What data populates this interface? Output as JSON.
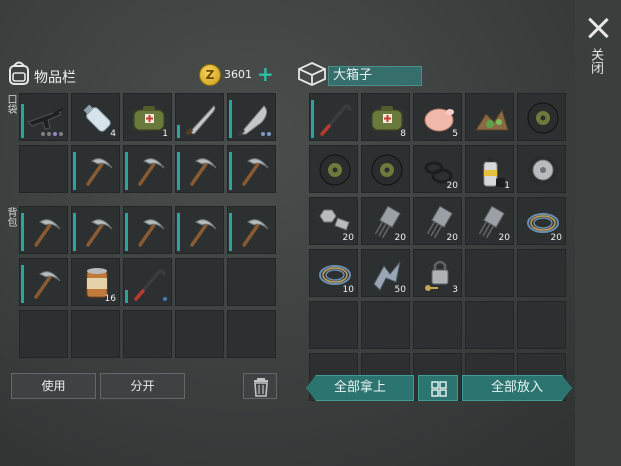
{
  "close": {
    "label": "关闭"
  },
  "inventory": {
    "title": "物品栏",
    "coins": "3601",
    "coin_symbol": "Z",
    "pocket_label": "口袋",
    "backpack_label": "背包",
    "pocket_slots": [
      {
        "item": "assault-rifle-icon",
        "qty": "",
        "dots": [
          "#7f7f7f",
          "#7f7f7f",
          "#9a7fd8",
          "#7f7f7f"
        ],
        "bar": 0.8
      },
      {
        "item": "water-bottle-icon",
        "qty": "4",
        "dots": [],
        "bar": 0
      },
      {
        "item": "medkit-bag-icon",
        "qty": "1",
        "dots": [],
        "bar": 0
      },
      {
        "item": "machete-icon",
        "qty": "",
        "dots": [],
        "bar": 0.3
      },
      {
        "item": "cleaver-icon",
        "qty": "",
        "dots": [
          "#7a9ac8",
          "#7a9ac8"
        ],
        "bar": 0.9
      },
      {
        "item": "",
        "qty": "",
        "dots": [],
        "bar": 0
      },
      {
        "item": "pickaxe-icon",
        "qty": "",
        "dots": [],
        "bar": 0.9
      },
      {
        "item": "pickaxe-icon",
        "qty": "",
        "dots": [],
        "bar": 0.9
      },
      {
        "item": "pickaxe-icon",
        "qty": "",
        "dots": [],
        "bar": 0.9
      },
      {
        "item": "pickaxe-icon",
        "qty": "",
        "dots": [],
        "bar": 0.9
      }
    ],
    "backpack_slots": [
      {
        "item": "pickaxe-icon",
        "qty": "",
        "dots": [],
        "bar": 0.9
      },
      {
        "item": "pickaxe-icon",
        "qty": "",
        "dots": [],
        "bar": 0.9
      },
      {
        "item": "pickaxe-icon",
        "qty": "",
        "dots": [],
        "bar": 0.9
      },
      {
        "item": "pickaxe-icon",
        "qty": "",
        "dots": [],
        "bar": 0.9
      },
      {
        "item": "pickaxe-icon",
        "qty": "",
        "dots": [],
        "bar": 0.9
      },
      {
        "item": "pickaxe-icon",
        "qty": "",
        "dots": [],
        "bar": 0.9
      },
      {
        "item": "canned-food-icon",
        "qty": "16",
        "dots": [],
        "bar": 0
      },
      {
        "item": "crowbar-icon",
        "qty": "",
        "dots": [
          "#4a7ab8"
        ],
        "bar": 0.3
      },
      {
        "item": "",
        "qty": "",
        "dots": [],
        "bar": 0
      },
      {
        "item": "",
        "qty": "",
        "dots": [],
        "bar": 0
      },
      {
        "item": "",
        "qty": "",
        "dots": [],
        "bar": 0
      },
      {
        "item": "",
        "qty": "",
        "dots": [],
        "bar": 0
      },
      {
        "item": "",
        "qty": "",
        "dots": [],
        "bar": 0
      },
      {
        "item": "",
        "qty": "",
        "dots": [],
        "bar": 0
      },
      {
        "item": "",
        "qty": "",
        "dots": [],
        "bar": 0
      }
    ],
    "buttons": {
      "use": "使用",
      "split": "分开"
    }
  },
  "container": {
    "title": "大箱子",
    "slots": [
      {
        "item": "crowbar-icon",
        "qty": "",
        "dots": [],
        "bar": 0.9
      },
      {
        "item": "medkit-bag-icon",
        "qty": "8",
        "dots": [],
        "bar": 0
      },
      {
        "item": "raw-chicken-icon",
        "qty": "5",
        "dots": [],
        "bar": 0
      },
      {
        "item": "herbs-pile-icon",
        "qty": "",
        "dots": [],
        "bar": 0
      },
      {
        "item": "car-tire-icon",
        "qty": "",
        "dots": [],
        "bar": 0
      },
      {
        "item": "car-tire-icon",
        "qty": "",
        "dots": [],
        "bar": 0
      },
      {
        "item": "car-tire-icon",
        "qty": "",
        "dots": [],
        "bar": 0
      },
      {
        "item": "rubber-gasket-icon",
        "qty": "20",
        "dots": [],
        "bar": 0
      },
      {
        "item": "spray-can-icon",
        "qty": "1",
        "dots": [],
        "bar": 0
      },
      {
        "item": "wheel-rim-icon",
        "qty": "",
        "dots": [],
        "bar": 0
      },
      {
        "item": "bolt-nut-icon",
        "qty": "20",
        "dots": [],
        "bar": 0
      },
      {
        "item": "transistor-icon",
        "qty": "20",
        "dots": [],
        "bar": 0
      },
      {
        "item": "transistor-icon",
        "qty": "20",
        "dots": [],
        "bar": 0
      },
      {
        "item": "transistor-icon",
        "qty": "20",
        "dots": [],
        "bar": 0
      },
      {
        "item": "wire-coil-icon",
        "qty": "20",
        "dots": [],
        "bar": 0
      },
      {
        "item": "wire-coil-icon",
        "qty": "10",
        "dots": [],
        "bar": 0
      },
      {
        "item": "metal-scrap-icon",
        "qty": "50",
        "dots": [],
        "bar": 0
      },
      {
        "item": "padlock-key-icon",
        "qty": "3",
        "dots": [],
        "bar": 0
      },
      {
        "item": "",
        "qty": "",
        "dots": [],
        "bar": 0
      },
      {
        "item": "",
        "qty": "",
        "dots": [],
        "bar": 0
      },
      {
        "item": "",
        "qty": "",
        "dots": [],
        "bar": 0
      },
      {
        "item": "",
        "qty": "",
        "dots": [],
        "bar": 0
      },
      {
        "item": "",
        "qty": "",
        "dots": [],
        "bar": 0
      },
      {
        "item": "",
        "qty": "",
        "dots": [],
        "bar": 0
      },
      {
        "item": "",
        "qty": "",
        "dots": [],
        "bar": 0
      },
      {
        "item": "",
        "qty": "",
        "dots": [],
        "bar": 0
      },
      {
        "item": "",
        "qty": "",
        "dots": [],
        "bar": 0
      },
      {
        "item": "",
        "qty": "",
        "dots": [],
        "bar": 0
      },
      {
        "item": "",
        "qty": "",
        "dots": [],
        "bar": 0
      },
      {
        "item": "",
        "qty": "",
        "dots": [],
        "bar": 0
      }
    ],
    "buttons": {
      "take_all": "全部拿上",
      "put_all": "全部放入"
    }
  },
  "colors": {
    "accent": "#2bc0a5",
    "teal_button": "#2c7470",
    "durability": "#2ba49a"
  }
}
